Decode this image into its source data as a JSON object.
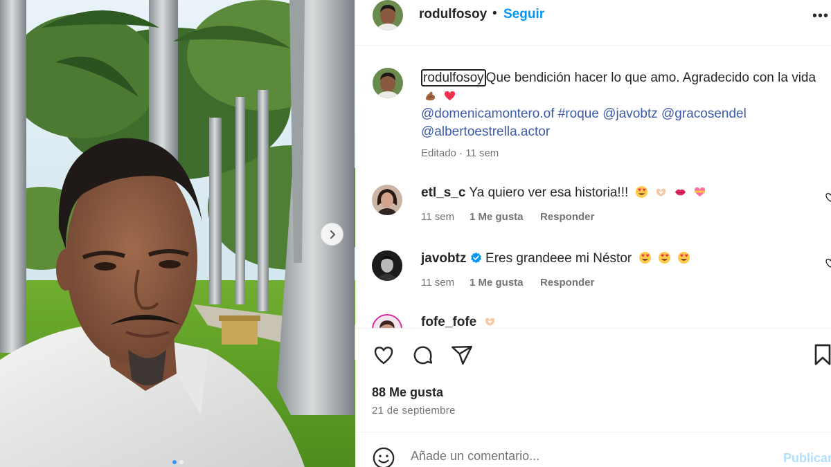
{
  "post": {
    "author": "rodulfosoy",
    "follow_sep": "•",
    "follow_label": "Seguir",
    "more_icon": "more-horizontal-icon",
    "caption_user": "rodulfosoy",
    "caption_text": "Que bendición hacer lo que amo. Agradecido con la vida",
    "caption_emoji": [
      "muscle-emoji",
      "red-heart-emoji"
    ],
    "tags": [
      "@domenicamontero.of",
      "#roque",
      "@javobtz",
      "@gracosendel",
      "@albertoestrella.actor"
    ],
    "edited": "Editado · 11 sem",
    "likes": "88 Me gusta",
    "date": "21 de septiembre"
  },
  "comments": [
    {
      "user": "etl_s_c",
      "text": "Ya quiero ver esa historia!!!",
      "emoji": [
        "heart-eyes-emoji",
        "heart-hands-emoji",
        "kiss-lips-emoji",
        "heart-ribbon-emoji"
      ],
      "time": "11 sem",
      "likes": "1 Me gusta",
      "reply": "Responder",
      "verified": false
    },
    {
      "user": "javobtz",
      "text": "Eres grandeee mi Néstor",
      "emoji": [
        "heart-eyes-emoji",
        "heart-eyes-emoji",
        "heart-eyes-emoji"
      ],
      "time": "11 sem",
      "likes": "1 Me gusta",
      "reply": "Responder",
      "verified": true
    },
    {
      "user": "fofe_fofe",
      "text": "",
      "emoji": [
        "heart-hands-emoji"
      ],
      "time": "",
      "likes": "",
      "reply": "",
      "verified": false
    }
  ],
  "add_comment": {
    "placeholder": "Añade un comentario...",
    "publish_label": "Publicar"
  },
  "colors": {
    "link_blue": "#0095f6",
    "tag_blue": "#3d5aa8",
    "muted_gray": "#737373",
    "text_dark": "#262626"
  }
}
